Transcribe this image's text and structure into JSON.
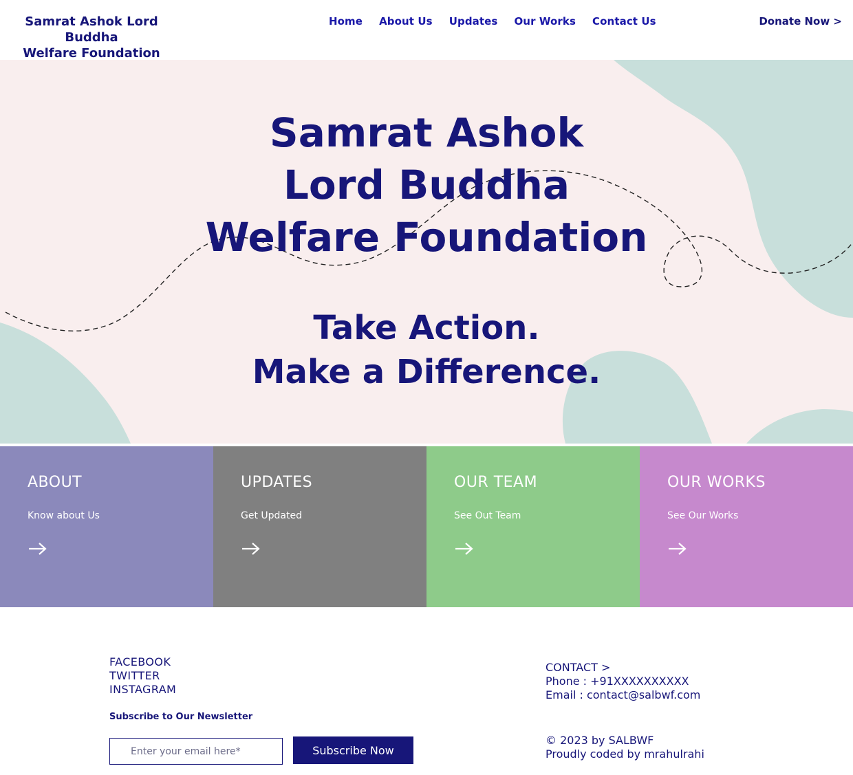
{
  "colors": {
    "brand_navy": "#171679",
    "nav_link": "#1a18a8",
    "hero_bg": "#f9eeee",
    "blob_teal": "#c8dfdb",
    "tile_about": "#8b89bb",
    "tile_updates": "#808080",
    "tile_team": "#8ecb8a",
    "tile_works": "#c689cd"
  },
  "header": {
    "brand_line1": "Samrat Ashok Lord Buddha",
    "brand_line2": "Welfare Foundation",
    "nav": [
      {
        "label": "Home"
      },
      {
        "label": "About Us"
      },
      {
        "label": "Updates"
      },
      {
        "label": "Our Works"
      },
      {
        "label": "Contact Us"
      }
    ],
    "donate_label": "Donate Now >"
  },
  "hero": {
    "title_lines": [
      "Samrat Ashok",
      "Lord Buddha",
      "Welfare Foundation"
    ],
    "subtitle_lines": [
      "Take Action.",
      "Make a Difference."
    ]
  },
  "tiles": [
    {
      "title": "ABOUT",
      "subtitle": "Know about Us",
      "icon": "arrow-right-icon"
    },
    {
      "title": "UPDATES",
      "subtitle": "Get Updated",
      "icon": "arrow-right-icon"
    },
    {
      "title": "OUR TEAM",
      "subtitle": "See Out Team",
      "icon": "arrow-right-icon"
    },
    {
      "title": "OUR WORKS",
      "subtitle": "See Our Works",
      "icon": "arrow-right-icon"
    }
  ],
  "footer": {
    "social": [
      "FACEBOOK",
      "TWITTER",
      "INSTAGRAM"
    ],
    "newsletter_label": "Subscribe to Our Newsletter",
    "email_placeholder": "Enter your email here*",
    "email_value": "",
    "subscribe_label": "Subscribe Now",
    "contact_link": "CONTACT >",
    "phone": "Phone : +91XXXXXXXXXX",
    "email": "Email : contact@salbwf.com",
    "copyright": "© 2023 by SALBWF",
    "credit": "Proudly coded by mrahulrahi"
  }
}
